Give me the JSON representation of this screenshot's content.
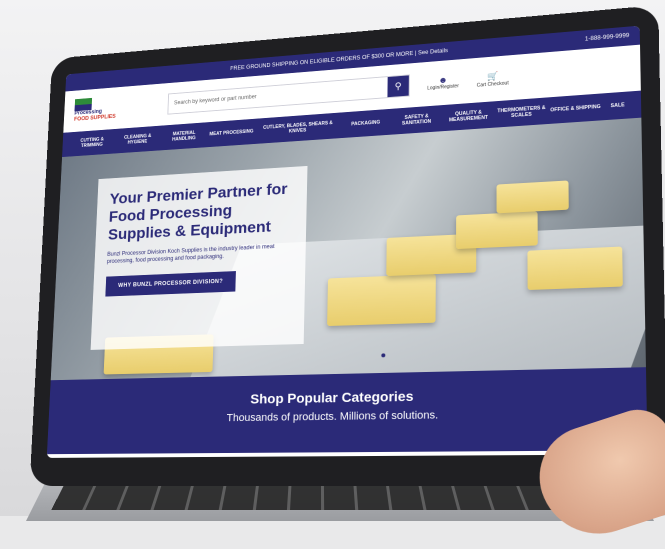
{
  "site": {
    "topbar_text": "FREE GROUND SHIPPING ON ELIGIBLE ORDERS OF $300 OR MORE | See Details",
    "phone": "1-888-999-9999",
    "logo_line1": "Processing",
    "logo_line2": "FOOD SUPPLIES",
    "search_placeholder": "Search by keyword or part number",
    "account_label": "Login/Register",
    "cart_label": "Cart Checkout",
    "nav_items": [
      "CUTTING & TRIMMING",
      "CLEANING & HYGIENE",
      "MATERIAL HANDLING",
      "MEAT PROCESSING",
      "CUTLERY, BLADES, SHEARS & KNIVES",
      "PACKAGING",
      "SAFETY & SANITATION",
      "QUALITY & MEASUREMENT",
      "THERMOMETERS & SCALES",
      "OFFICE & SHIPPING",
      "SALE"
    ],
    "hero_title": "Your Premier Partner for Food Processing Supplies & Equipment",
    "hero_text": "Bunzl Processor Division Koch Supplies is the industry leader in meat processing, food processing and food packaging.",
    "hero_cta": "WHY BUNZL PROCESSOR DIVISION?",
    "categories_title": "Shop Popular Categories",
    "categories_subtitle": "Thousands of products. Millions of solutions."
  },
  "colors": {
    "brand_navy": "#2b2a78",
    "brand_green": "#2e8b3a",
    "brand_red": "#d0392b"
  }
}
